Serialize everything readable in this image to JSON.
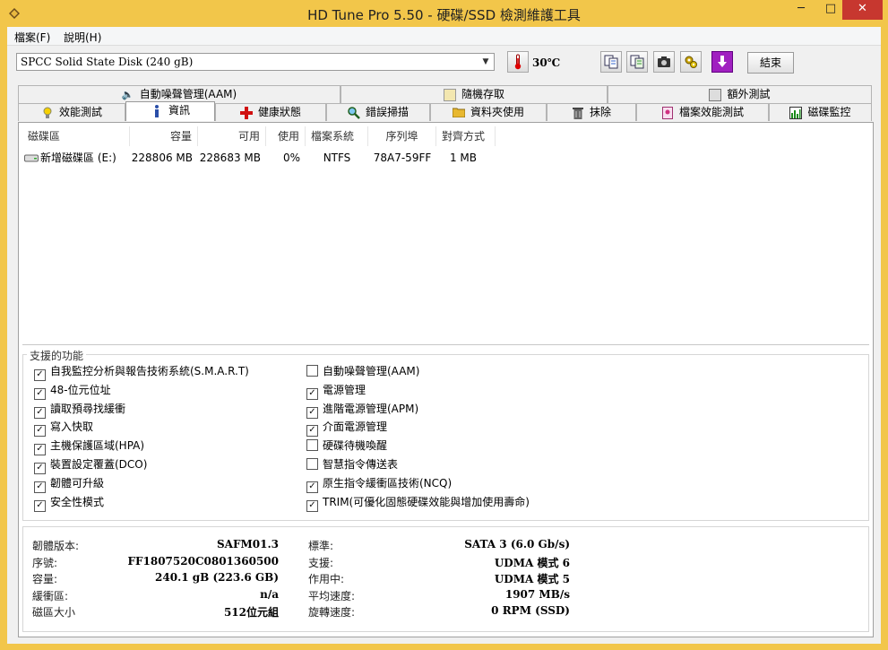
{
  "window": {
    "title": "HD Tune Pro 5.50 - 硬碟/SSD 檢測維護工具",
    "minimize": "─",
    "maximize": "□",
    "close": "✕"
  },
  "menu": [
    "檔案(F)",
    "說明(H)"
  ],
  "toolbar": {
    "drive": "SPCC Solid State Disk (240 gB)",
    "temperature": "30℃",
    "exit_label": "結束"
  },
  "tabs_top": [
    "自動噪聲管理(AAM)",
    "隨機存取",
    "額外測試"
  ],
  "tabs_bottom": [
    "效能測試",
    "資訊",
    "健康狀態",
    "錯誤掃描",
    "資料夾使用",
    "抹除",
    "檔案效能測試",
    "磁碟監控"
  ],
  "partition_table": {
    "headers": [
      "磁碟區",
      "容量",
      "可用",
      "使用",
      "檔案系統",
      "序列埠",
      "對齊方式"
    ],
    "rows": [
      [
        "新增磁碟區 (E:)",
        "228806 MB",
        "228683 MB",
        "0%",
        "NTFS",
        "78A7-59FF",
        "1 MB"
      ]
    ]
  },
  "features": {
    "title": "支援的功能",
    "left": [
      {
        "label": "自我監控分析與報告技術系統(S.M.A.R.T)",
        "checked": true
      },
      {
        "label": "48-位元位址",
        "checked": true
      },
      {
        "label": "讀取預尋找緩衝",
        "checked": true
      },
      {
        "label": "寫入快取",
        "checked": true
      },
      {
        "label": "主機保護區域(HPA)",
        "checked": true
      },
      {
        "label": "裝置設定覆蓋(DCO)",
        "checked": true
      },
      {
        "label": "韌體可升級",
        "checked": true
      },
      {
        "label": "安全性模式",
        "checked": true
      }
    ],
    "right": [
      {
        "label": "自動噪聲管理(AAM)",
        "checked": false
      },
      {
        "label": "電源管理",
        "checked": true
      },
      {
        "label": "進階電源管理(APM)",
        "checked": true
      },
      {
        "label": "介面電源管理",
        "checked": true
      },
      {
        "label": "硬碟待機喚醒",
        "checked": false
      },
      {
        "label": "智慧指令傳送表",
        "checked": false
      },
      {
        "label": "原生指令緩衝區技術(NCQ)",
        "checked": true
      },
      {
        "label": "TRIM(可優化固態硬碟效能與增加使用壽命)",
        "checked": true
      }
    ]
  },
  "info": {
    "left": [
      {
        "label": "韌體版本:",
        "value": "SAFM01.3"
      },
      {
        "label": "序號:",
        "value": "FF1807520C0801360500"
      },
      {
        "label": "容量:",
        "value": "240.1 gB (223.6 GB)"
      },
      {
        "label": "緩衝區:",
        "value": "n/a"
      },
      {
        "label": "磁區大小",
        "value": "512位元組"
      }
    ],
    "right": [
      {
        "label": "標準:",
        "value": "SATA 3 (6.0 Gb/s)"
      },
      {
        "label": "支援:",
        "value": "UDMA 模式 6"
      },
      {
        "label": "作用中:",
        "value": "UDMA 模式 5"
      },
      {
        "label": "平均速度:",
        "value": "1907 MB/s"
      },
      {
        "label": "旋轉速度:",
        "value": "0 RPM (SSD)"
      }
    ]
  }
}
